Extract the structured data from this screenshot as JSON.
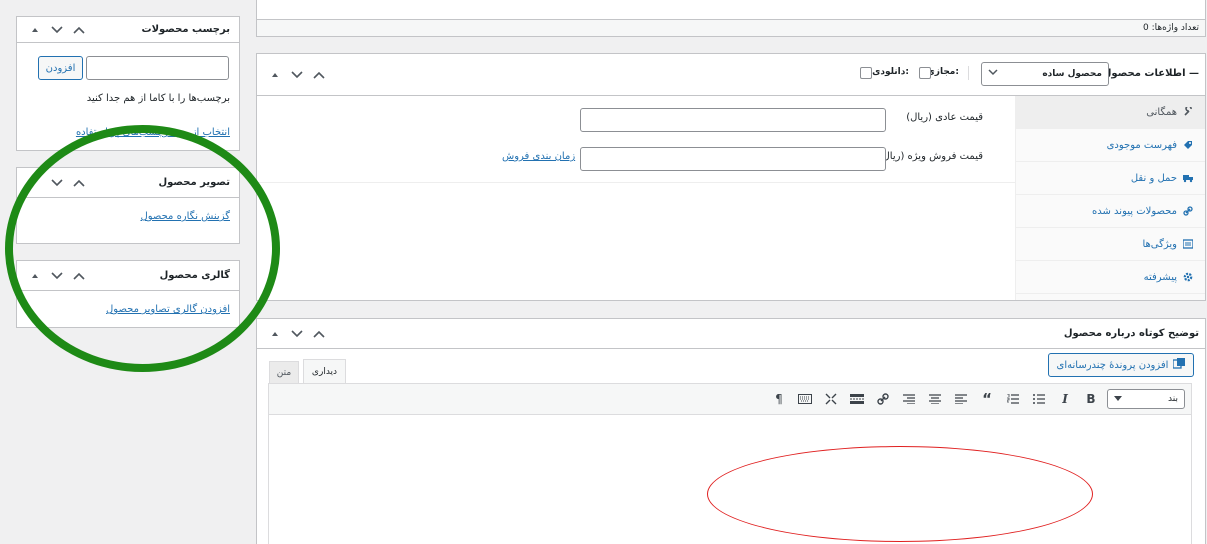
{
  "word_count": {
    "label": "تعداد واژه‌ها: 0"
  },
  "tags_box": {
    "title": "برچسب محصولات",
    "add_button": "افزودن",
    "hint": "برچسب‌ها را با کاما از هم جدا کنید",
    "choose_link": "انتخاب از بین برچسب‌های پر استفاده"
  },
  "image_box": {
    "title": "تصویر محصول",
    "set_link": "گزینش نگاره محصول"
  },
  "gallery_box": {
    "title": "گالری محصول",
    "add_link": "افزودن گالری تصاویر محصول"
  },
  "product_data": {
    "title": "اطلاعات محصول —",
    "type_select": "محصول ساده",
    "virtual_label": "مجازی:",
    "downloadable_label": "دانلودی:",
    "tabs": [
      {
        "label": "همگانی",
        "icon": "wrench-icon"
      },
      {
        "label": "فهرست موجودی",
        "icon": "tag-icon"
      },
      {
        "label": "حمل و نقل",
        "icon": "truck-icon"
      },
      {
        "label": "محصولات پیوند شده",
        "icon": "link-icon"
      },
      {
        "label": "ویژگی‌ها",
        "icon": "list-icon"
      },
      {
        "label": "پیشرفته",
        "icon": "gear-icon"
      }
    ],
    "regular_price_label": "قیمت عادی (ریال)",
    "sale_price_label": "قیمت فروش ویژه (ریال)",
    "schedule_link": "زمان بندی فروش"
  },
  "short_description": {
    "title": "توضیح کوتاه درباره محصول",
    "add_media_button": "افزودن پروندهٔ چندرسانه‌ای",
    "tab_visual": "دیداری",
    "tab_text": "متن",
    "format_select": "بند"
  },
  "colors": {
    "green_annotation": "#1e8a16",
    "red_annotation": "#e02020",
    "link": "#2271b1"
  }
}
